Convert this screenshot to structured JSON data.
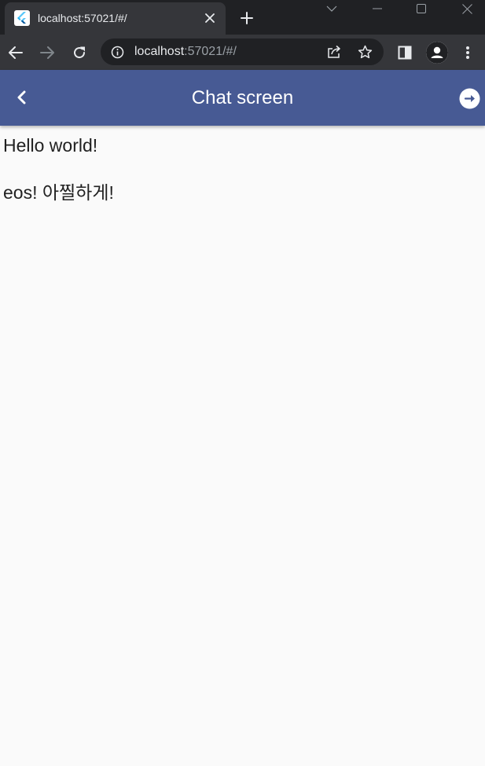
{
  "browser": {
    "tab": {
      "title": "localhost:57021/#/",
      "favicon": "flutter-icon"
    },
    "url": {
      "host": "localhost",
      "rest": ":57021/#/"
    },
    "icons": {
      "back": "arrow-left-icon",
      "forward": "arrow-right-icon",
      "reload": "reload-icon",
      "info": "info-icon",
      "share": "share-icon",
      "bookmark": "star-icon",
      "side_panel": "side-panel-icon",
      "profile": "person-icon",
      "menu": "kebab-menu-icon"
    }
  },
  "app": {
    "appbar": {
      "title": "Chat screen",
      "color": "#475a94",
      "back_icon": "chevron-left-icon",
      "next_icon": "arrow-circle-right-icon"
    },
    "messages": [
      "Hello world!",
      "eos! 아찔하게!"
    ]
  }
}
